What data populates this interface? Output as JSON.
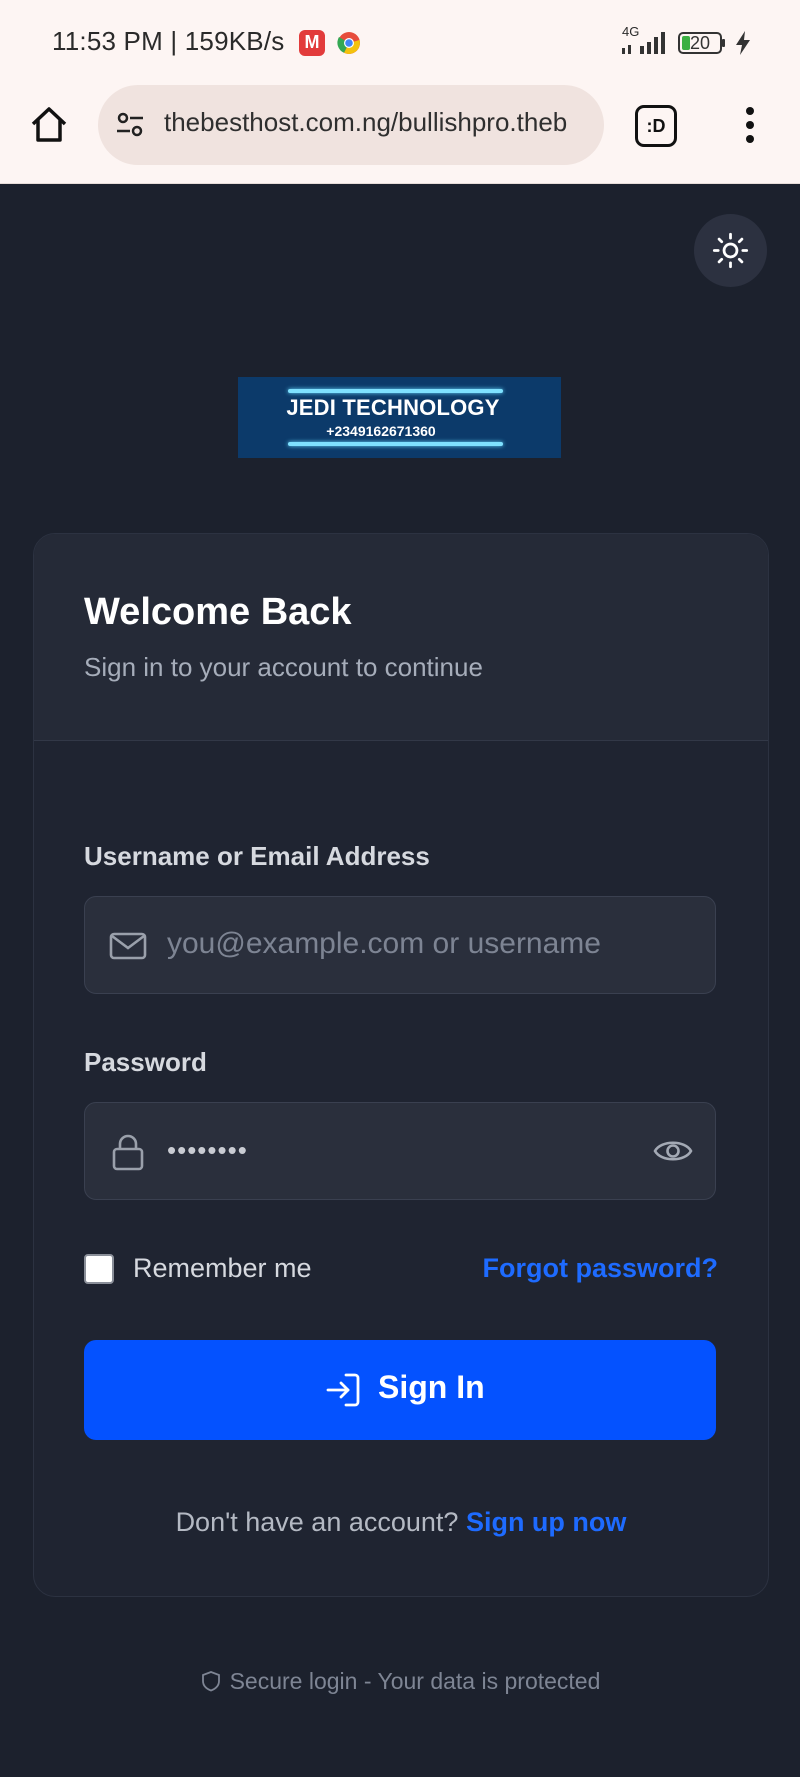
{
  "status_bar": {
    "time": "11:53 PM | 159KB/s",
    "network": "4G",
    "battery": "20"
  },
  "browser": {
    "url": "thebesthost.com.ng/bullishpro.theb",
    "tabs_label": ":D"
  },
  "logo": {
    "title": "JEDI TECHNOLOGY",
    "phone": "+2349162671360"
  },
  "card": {
    "title": "Welcome Back",
    "subtitle": "Sign in to your account to continue",
    "username_label": "Username or Email Address",
    "username_placeholder": "you@example.com or username",
    "password_label": "Password",
    "password_value": "••••••••",
    "remember_label": "Remember me",
    "forgot_label": "Forgot password?",
    "signin_label": "Sign In",
    "signup_prompt": "Don't have an account?",
    "signup_link": "Sign up now"
  },
  "footer": {
    "text": "Secure login - Your data is protected"
  },
  "colors": {
    "background": "#1c212d",
    "card": "#1f2431",
    "accent": "#0452ff",
    "link": "#1e6bff"
  }
}
